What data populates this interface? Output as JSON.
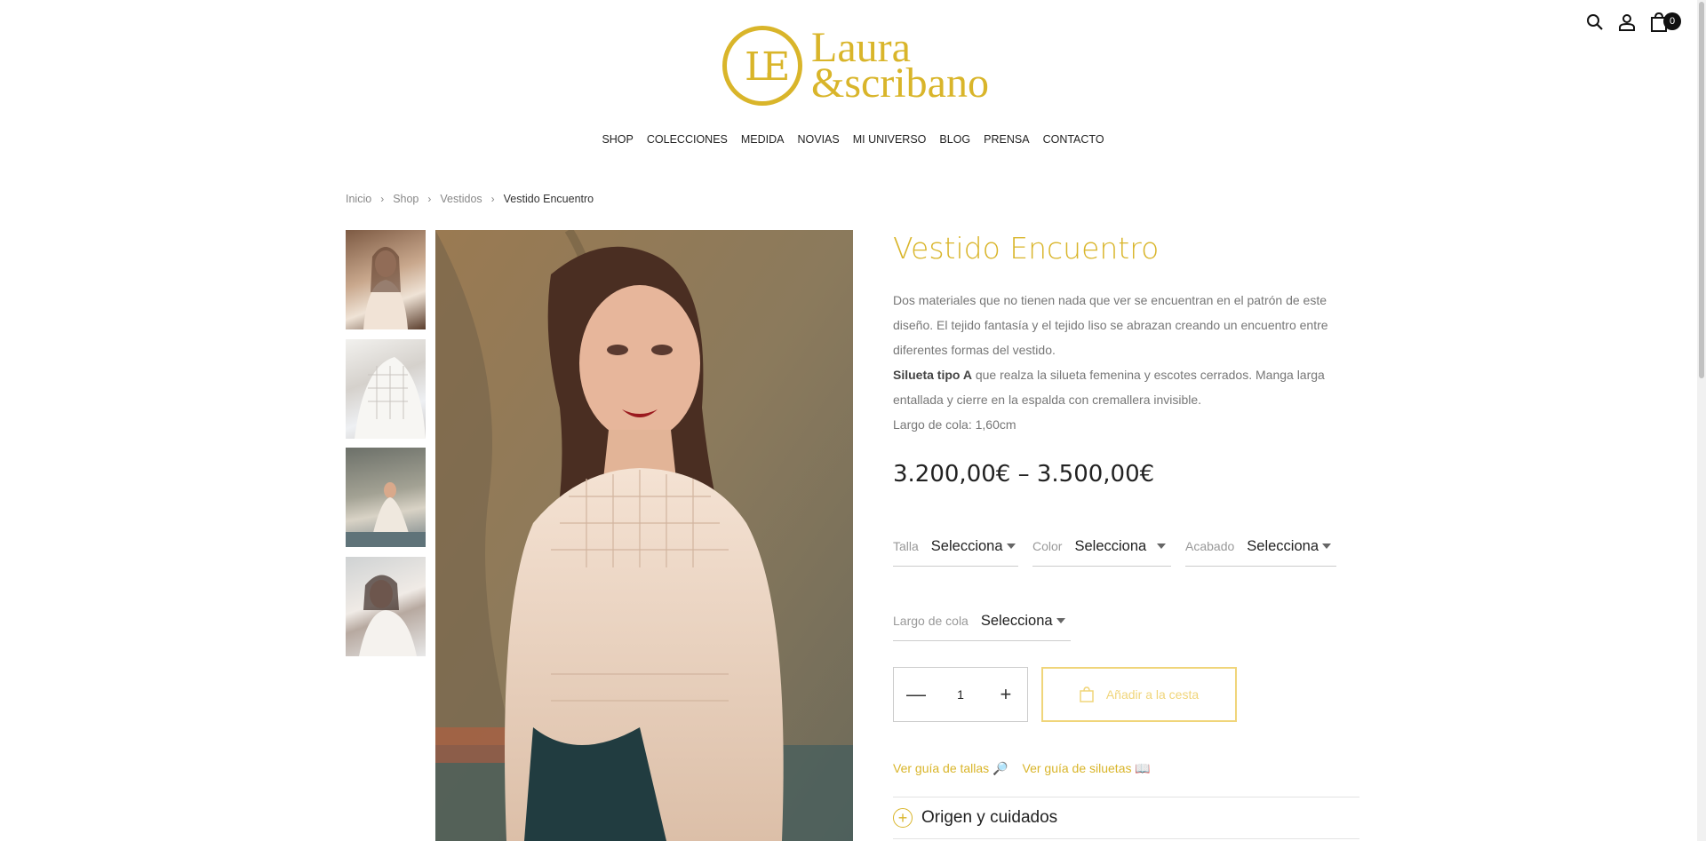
{
  "brand": {
    "line1": "Laura",
    "line2": "&scribano",
    "mark": "LE"
  },
  "header": {
    "cart_count": "0"
  },
  "nav": [
    "SHOP",
    "COLECCIONES",
    "MEDIDA",
    "NOVIAS",
    "MI UNIVERSO",
    "BLOG",
    "PRENSA",
    "CONTACTO"
  ],
  "breadcrumb": {
    "items": [
      "Inicio",
      "Shop",
      "Vestidos"
    ],
    "current": "Vestido Encuentro"
  },
  "product": {
    "title": "Vestido Encuentro",
    "desc_p1": "Dos materiales que no tienen nada que ver se encuentran en el patrón de este diseño. El tejido fantasía y el tejido liso se abrazan creando un encuentro entre diferentes formas del vestido.",
    "desc_bold": "Silueta tipo A",
    "desc_p2": " que realza la silueta femenina y escotes cerrados. Manga larga entallada y cierre en la espalda con cremallera invisible.",
    "desc_p3": "Largo de cola: 1,60cm",
    "price": "3.200,00€ – 3.500,00€"
  },
  "variations": [
    {
      "label": "Talla",
      "value": "Selecciona"
    },
    {
      "label": "Color",
      "value": "Selecciona"
    },
    {
      "label": "Acabado",
      "value": "Selecciona"
    },
    {
      "label": "Largo de cola",
      "value": "Selecciona"
    }
  ],
  "quantity": {
    "value": "1",
    "minus": "—",
    "plus": "+"
  },
  "add_to_cart": "Añadir a la cesta",
  "links": {
    "size_guide": "Ver guía de tallas 🔎",
    "silhouette_guide": "Ver guía de siluetas 📖"
  },
  "accordion": {
    "label": "Origen y cuidados"
  },
  "colors": {
    "gold": "#d9b52a",
    "gold_light": "#f0d57a",
    "text": "#333333"
  },
  "icons": [
    "search-icon",
    "user-icon",
    "bag-icon",
    "cart-icon",
    "plus-circle-icon"
  ]
}
